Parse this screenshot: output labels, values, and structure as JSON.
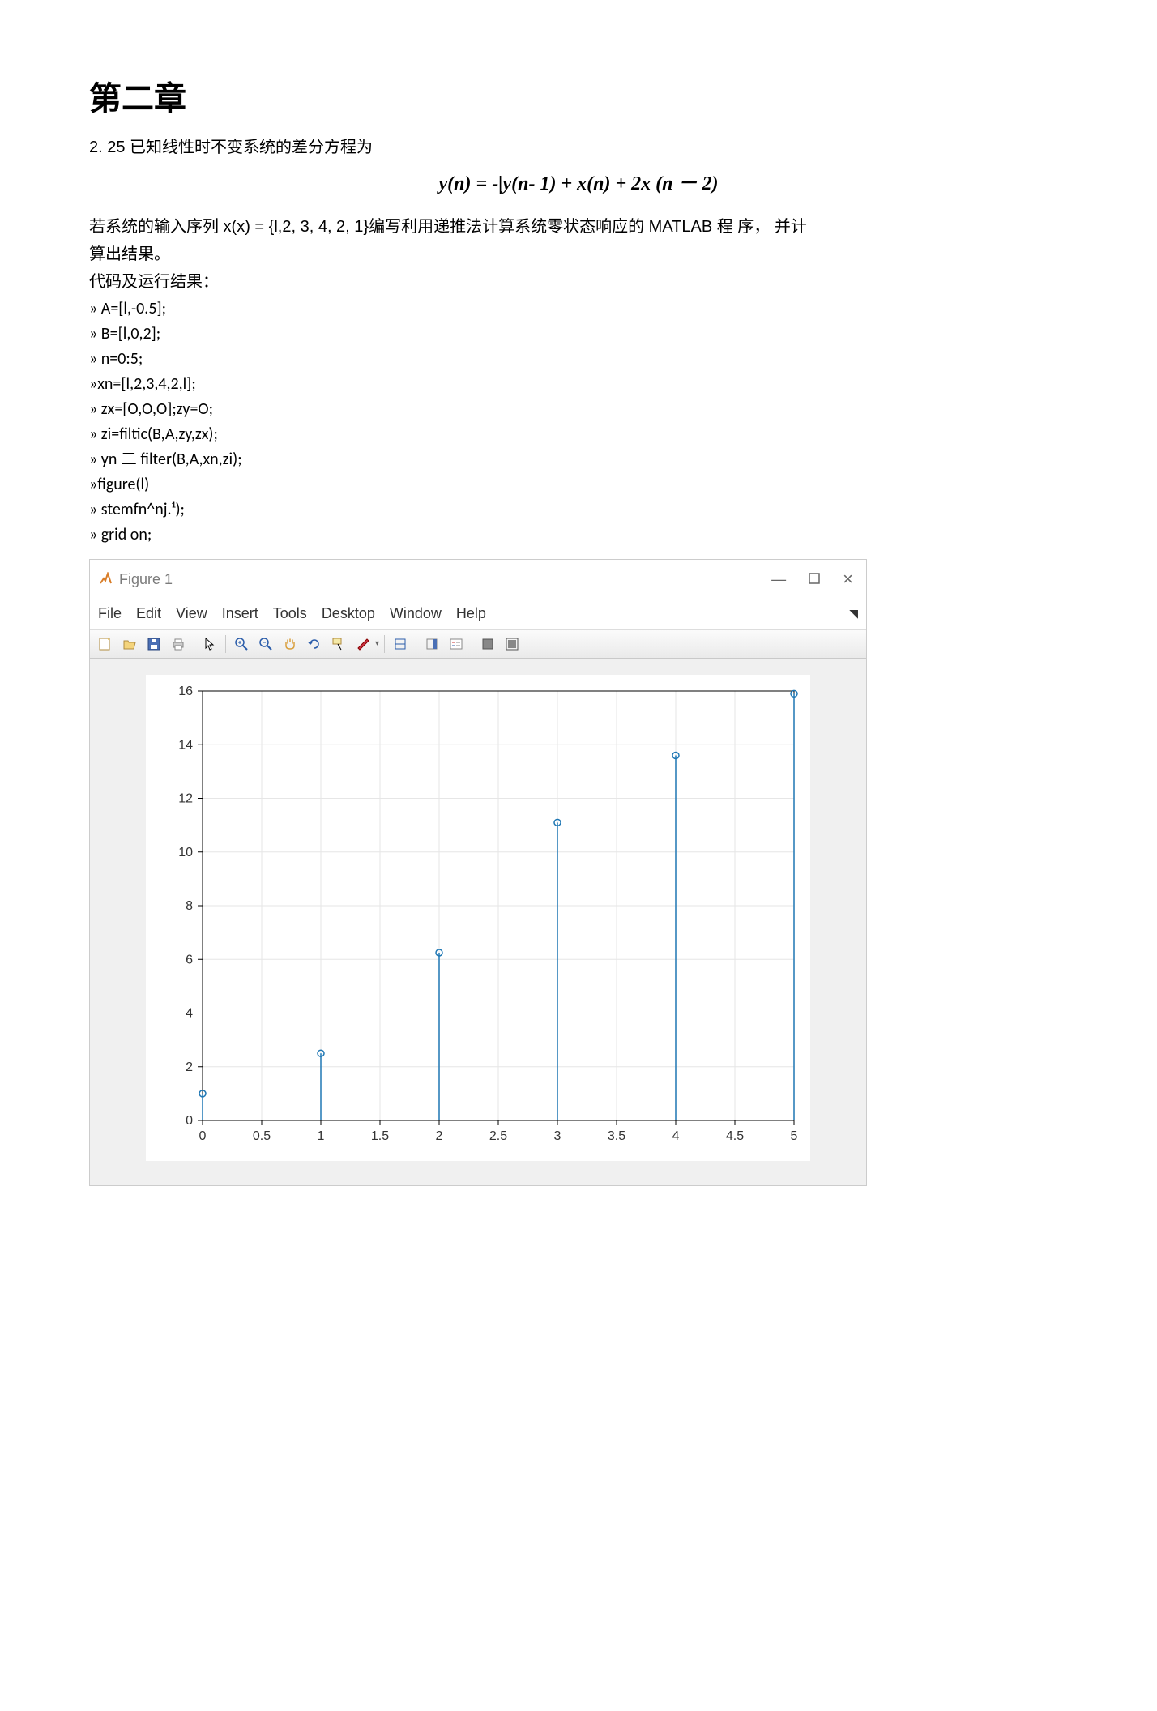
{
  "heading": "第二章",
  "problem_num": "2. 25 已知线性时不变系统的差分方程为",
  "equation": "y(n) = -|y(n- 1) + x(n) + 2x (n － 2)",
  "desc1": "若系统的输入序列 x(x) = {l,2, 3, 4, 2, 1}编写利用递推法计算系统零状态响应的 MATLAB 程  序， 并计",
  "desc2": "算出结果。",
  "label_code": "代码及运行结果：",
  "code": [
    "» A=[l,-0.5];",
    "» B=[l,0,2];",
    "» n=0:5;",
    "»xn=[l,2,3,4,2,l];",
    "» zx=[O,O,O];zy=O;",
    "» zi=filtic(B,A,zy,zx);",
    "» yn 二 filter(B,A,xn,zi);",
    "»figure(l)",
    "» stemfn^nj.¹);",
    "» grid on;"
  ],
  "figure": {
    "title": "Figure 1",
    "menu": [
      "File",
      "Edit",
      "View",
      "Insert",
      "Tools",
      "Desktop",
      "Window",
      "Help"
    ]
  },
  "chart_data": {
    "type": "stem",
    "x": [
      0,
      1,
      2,
      3,
      4,
      5
    ],
    "y": [
      1.0,
      2.5,
      6.25,
      11.1,
      13.6,
      15.9
    ],
    "xlim": [
      0,
      5
    ],
    "ylim": [
      0,
      16
    ],
    "xticks": [
      0,
      0.5,
      1,
      1.5,
      2,
      2.5,
      3,
      3.5,
      4,
      4.5,
      5
    ],
    "yticks": [
      0,
      2,
      4,
      6,
      8,
      10,
      12,
      14,
      16
    ],
    "grid": true
  }
}
